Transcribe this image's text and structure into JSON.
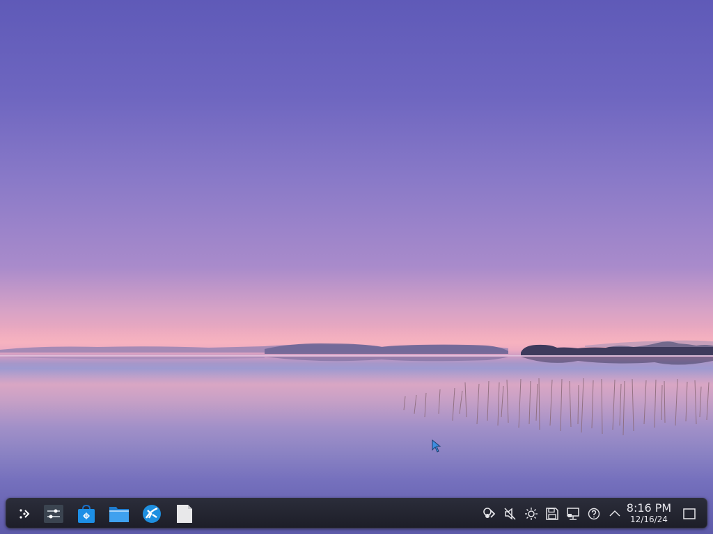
{
  "desktop": {
    "wallpaper": "lake-dusk",
    "sky_top_color": "#5f5ab8",
    "horizon_color": "#f0adbd"
  },
  "taskbar": {
    "launchers": [
      {
        "name": "application-launcher",
        "icon": "kde-menu-icon"
      },
      {
        "name": "system-settings",
        "icon": "sliders-icon"
      },
      {
        "name": "discover",
        "icon": "shopping-bag-icon"
      },
      {
        "name": "dolphin",
        "icon": "folder-icon"
      },
      {
        "name": "browser",
        "icon": "globe-icon"
      },
      {
        "name": "text-editor",
        "icon": "document-icon"
      }
    ],
    "tray": [
      {
        "name": "kde-connect",
        "icon": "kde-connect-icon"
      },
      {
        "name": "volume",
        "icon": "speaker-muted-icon"
      },
      {
        "name": "brightness",
        "icon": "sun-icon"
      },
      {
        "name": "disks",
        "icon": "floppy-icon"
      },
      {
        "name": "network",
        "icon": "network-wired-icon"
      },
      {
        "name": "help",
        "icon": "help-circle-icon"
      },
      {
        "name": "expand",
        "icon": "chevron-up-icon"
      }
    ],
    "clock": {
      "time": "8:16 PM",
      "date": "12/16/24"
    },
    "show_desktop": {
      "icon": "show-desktop-icon"
    }
  }
}
